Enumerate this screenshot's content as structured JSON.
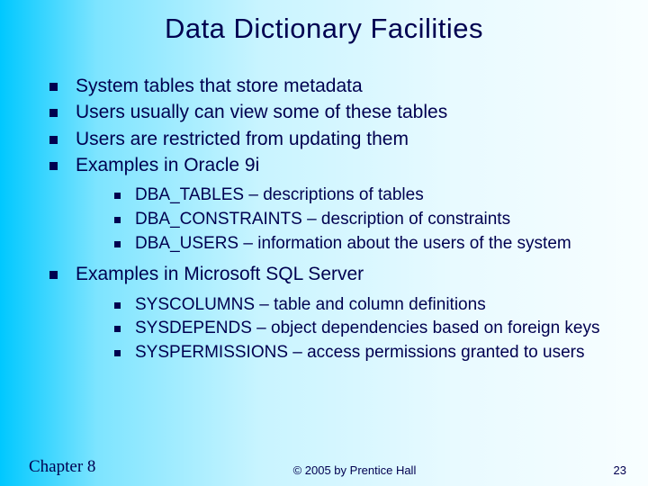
{
  "title": "Data Dictionary Facilities",
  "bullets": [
    "System tables that store metadata",
    "Users usually can view some of these tables",
    "Users are restricted from updating them",
    "Examples in Oracle 9i"
  ],
  "oracle_examples": [
    "DBA_TABLES – descriptions of tables",
    "DBA_CONSTRAINTS – description of constraints",
    "DBA_USERS – information about the users of the system"
  ],
  "sql_bullet": "Examples in Microsoft SQL Server",
  "sql_examples": [
    "SYSCOLUMNS – table and column definitions",
    "SYSDEPENDS – object dependencies based on foreign keys",
    "SYSPERMISSIONS – access permissions granted to users"
  ],
  "footer": {
    "chapter": "Chapter 8",
    "copyright": "© 2005 by Prentice Hall",
    "page": "23"
  }
}
